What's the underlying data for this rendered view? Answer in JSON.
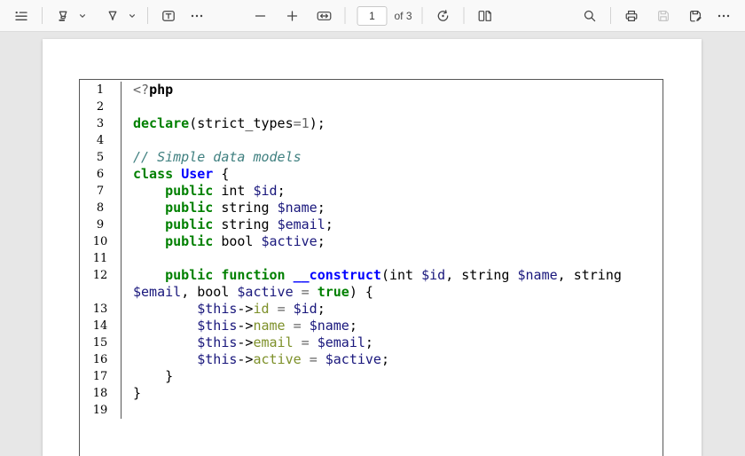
{
  "toolbar": {
    "page_value": "1",
    "page_of": "of 3",
    "icons": {
      "left": [
        "table-of-contents",
        "highlighter",
        "chevron-down",
        "draw-pen",
        "chevron-down",
        "add-text",
        "more-options"
      ],
      "center": [
        "zoom-out",
        "zoom-in",
        "fit-to-width",
        "rotate",
        "page-view"
      ],
      "right": [
        "search",
        "print",
        "save",
        "save-as",
        "more-options"
      ],
      "disabled": [
        "save"
      ]
    }
  },
  "colors": {
    "toolbar_bg": "#f9f9f9",
    "canvas_bg": "#e7e7e7",
    "page_bg": "#ffffff",
    "code_border": "#565656",
    "icon": "#444444",
    "icon_disabled": "#c6c6c6"
  },
  "document": {
    "token_styles": {
      "k": {
        "color": "#008000",
        "bold": true
      },
      "nb": {
        "color": "#0000FF",
        "bold": true
      },
      "nf": {
        "color": "#0000FF",
        "bold": true
      },
      "v": {
        "color": "#19177C"
      },
      "a": {
        "color": "#7D9029"
      },
      "o": {
        "color": "#666666"
      },
      "c": {
        "color": "#408080",
        "italic": true
      },
      "p": {
        "color": "#000000"
      },
      "pb": {
        "color": "#000000",
        "bold": true
      }
    },
    "lines": [
      {
        "n": "1",
        "t": [
          [
            "<?",
            "o"
          ],
          [
            "php",
            "pb"
          ]
        ]
      },
      {
        "n": "2",
        "t": []
      },
      {
        "n": "3",
        "t": [
          [
            "declare",
            "k"
          ],
          [
            "(strict_types",
            "p"
          ],
          [
            "=",
            "o"
          ],
          [
            "1",
            "o"
          ],
          [
            ");",
            "p"
          ]
        ]
      },
      {
        "n": "4",
        "t": []
      },
      {
        "n": "5",
        "t": [
          [
            "// Simple data models",
            "c"
          ]
        ]
      },
      {
        "n": "6",
        "t": [
          [
            "class",
            "k"
          ],
          [
            " ",
            "p"
          ],
          [
            "User",
            "nb"
          ],
          [
            " {",
            "p"
          ]
        ]
      },
      {
        "n": "7",
        "t": [
          [
            "    ",
            "p"
          ],
          [
            "public",
            "k"
          ],
          [
            " int ",
            "p"
          ],
          [
            "$id",
            "v"
          ],
          [
            ";",
            "p"
          ]
        ]
      },
      {
        "n": "8",
        "t": [
          [
            "    ",
            "p"
          ],
          [
            "public",
            "k"
          ],
          [
            " string ",
            "p"
          ],
          [
            "$name",
            "v"
          ],
          [
            ";",
            "p"
          ]
        ]
      },
      {
        "n": "9",
        "t": [
          [
            "    ",
            "p"
          ],
          [
            "public",
            "k"
          ],
          [
            " string ",
            "p"
          ],
          [
            "$email",
            "v"
          ],
          [
            ";",
            "p"
          ]
        ]
      },
      {
        "n": "10",
        "t": [
          [
            "    ",
            "p"
          ],
          [
            "public",
            "k"
          ],
          [
            " bool ",
            "p"
          ],
          [
            "$active",
            "v"
          ],
          [
            ";",
            "p"
          ]
        ]
      },
      {
        "n": "11",
        "t": []
      },
      {
        "n": "12",
        "t": [
          [
            "    ",
            "p"
          ],
          [
            "public",
            "k"
          ],
          [
            " ",
            "p"
          ],
          [
            "function",
            "k"
          ],
          [
            " ",
            "p"
          ],
          [
            "__construct",
            "nf"
          ],
          [
            "(int ",
            "p"
          ],
          [
            "$id",
            "v"
          ],
          [
            ", string ",
            "p"
          ],
          [
            "$name",
            "v"
          ],
          [
            ", string",
            "p"
          ],
          [
            "\n",
            "p"
          ],
          [
            "$email",
            "v"
          ],
          [
            ", bool ",
            "p"
          ],
          [
            "$active",
            "v"
          ],
          [
            " ",
            "p"
          ],
          [
            "=",
            "o"
          ],
          [
            " ",
            "p"
          ],
          [
            "true",
            "k"
          ],
          [
            ") {",
            "p"
          ]
        ]
      },
      {
        "n": "13",
        "t": [
          [
            "        ",
            "p"
          ],
          [
            "$this",
            "v"
          ],
          [
            "->",
            "p"
          ],
          [
            "id",
            "a"
          ],
          [
            " ",
            "p"
          ],
          [
            "=",
            "o"
          ],
          [
            " ",
            "p"
          ],
          [
            "$id",
            "v"
          ],
          [
            ";",
            "p"
          ]
        ]
      },
      {
        "n": "14",
        "t": [
          [
            "        ",
            "p"
          ],
          [
            "$this",
            "v"
          ],
          [
            "->",
            "p"
          ],
          [
            "name",
            "a"
          ],
          [
            " ",
            "p"
          ],
          [
            "=",
            "o"
          ],
          [
            " ",
            "p"
          ],
          [
            "$name",
            "v"
          ],
          [
            ";",
            "p"
          ]
        ]
      },
      {
        "n": "15",
        "t": [
          [
            "        ",
            "p"
          ],
          [
            "$this",
            "v"
          ],
          [
            "->",
            "p"
          ],
          [
            "email",
            "a"
          ],
          [
            " ",
            "p"
          ],
          [
            "=",
            "o"
          ],
          [
            " ",
            "p"
          ],
          [
            "$email",
            "v"
          ],
          [
            ";",
            "p"
          ]
        ]
      },
      {
        "n": "16",
        "t": [
          [
            "        ",
            "p"
          ],
          [
            "$this",
            "v"
          ],
          [
            "->",
            "p"
          ],
          [
            "active",
            "a"
          ],
          [
            " ",
            "p"
          ],
          [
            "=",
            "o"
          ],
          [
            " ",
            "p"
          ],
          [
            "$active",
            "v"
          ],
          [
            ";",
            "p"
          ]
        ]
      },
      {
        "n": "17",
        "t": [
          [
            "    }",
            "p"
          ]
        ]
      },
      {
        "n": "18",
        "t": [
          [
            "}",
            "p"
          ]
        ]
      },
      {
        "n": "19",
        "t": []
      }
    ]
  }
}
